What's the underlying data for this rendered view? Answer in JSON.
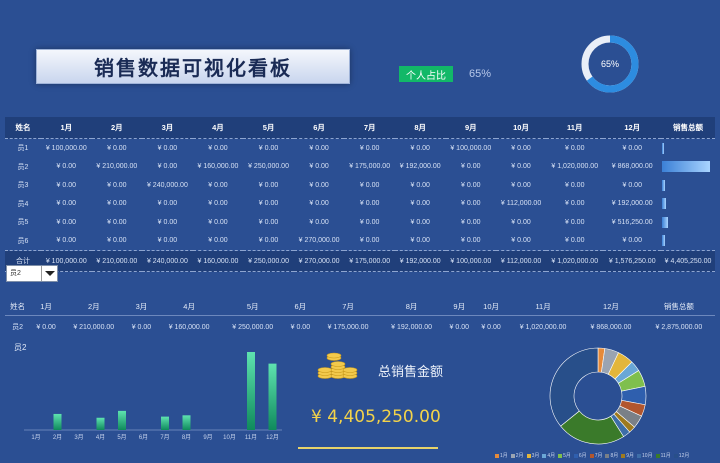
{
  "title": "销售数据可视化看板",
  "tag": "个人占比",
  "percent": "65%",
  "gauge": {
    "label": "65%",
    "value": 0.65
  },
  "table": {
    "headers": [
      "姓名",
      "1月",
      "2月",
      "3月",
      "4月",
      "5月",
      "6月",
      "7月",
      "8月",
      "9月",
      "10月",
      "11月",
      "12月",
      "销售总额"
    ],
    "rows": [
      {
        "name": "员1",
        "values": [
          "¥ 100,000.00",
          "¥ 0.00",
          "¥ 0.00",
          "¥ 0.00",
          "¥ 0.00",
          "¥ 0.00",
          "¥ 0.00",
          "¥ 0.00",
          "¥ 100,000.00",
          "¥ 0.00",
          "¥ 0.00",
          "¥ 0.00"
        ],
        "total_share": 0.03
      },
      {
        "name": "员2",
        "values": [
          "¥ 0.00",
          "¥ 210,000.00",
          "¥ 0.00",
          "¥ 160,000.00",
          "¥ 250,000.00",
          "¥ 0.00",
          "¥ 175,000.00",
          "¥ 192,000.00",
          "¥ 0.00",
          "¥ 0.00",
          "¥ 1,020,000.00",
          "¥ 868,000.00"
        ],
        "total_share": 0.96
      },
      {
        "name": "员3",
        "values": [
          "¥ 0.00",
          "¥ 0.00",
          "¥ 240,000.00",
          "¥ 0.00",
          "¥ 0.00",
          "¥ 0.00",
          "¥ 0.00",
          "¥ 0.00",
          "¥ 0.00",
          "¥ 0.00",
          "¥ 0.00",
          "¥ 0.00"
        ],
        "total_share": 0.05
      },
      {
        "name": "员4",
        "values": [
          "¥ 0.00",
          "¥ 0.00",
          "¥ 0.00",
          "¥ 0.00",
          "¥ 0.00",
          "¥ 0.00",
          "¥ 0.00",
          "¥ 0.00",
          "¥ 0.00",
          "¥ 112,000.00",
          "¥ 0.00",
          "¥ 192,000.00"
        ],
        "total_share": 0.07
      },
      {
        "name": "员5",
        "values": [
          "¥ 0.00",
          "¥ 0.00",
          "¥ 0.00",
          "¥ 0.00",
          "¥ 0.00",
          "¥ 0.00",
          "¥ 0.00",
          "¥ 0.00",
          "¥ 0.00",
          "¥ 0.00",
          "¥ 0.00",
          "¥ 516,250.00"
        ],
        "total_share": 0.12
      },
      {
        "name": "员6",
        "values": [
          "¥ 0.00",
          "¥ 0.00",
          "¥ 0.00",
          "¥ 0.00",
          "¥ 0.00",
          "¥ 270,000.00",
          "¥ 0.00",
          "¥ 0.00",
          "¥ 0.00",
          "¥ 0.00",
          "¥ 0.00",
          "¥ 0.00"
        ],
        "total_share": 0.06
      }
    ],
    "total": {
      "name": "合计",
      "values": [
        "¥ 100,000.00",
        "¥ 210,000.00",
        "¥ 240,000.00",
        "¥ 160,000.00",
        "¥ 250,000.00",
        "¥ 270,000.00",
        "¥ 175,000.00",
        "¥ 192,000.00",
        "¥ 100,000.00",
        "¥ 112,000.00",
        "¥ 1,020,000.00",
        "¥ 1,576,250.00"
      ],
      "grand": "¥ 4,405,250.00"
    }
  },
  "selector": {
    "value": "员2"
  },
  "detail": {
    "headers": [
      "姓名",
      "1月",
      "2月",
      "3月",
      "4月",
      "5月",
      "6月",
      "7月",
      "8月",
      "9月",
      "10月",
      "11月",
      "12月",
      "销售总额"
    ],
    "row": [
      "员2",
      "¥ 0.00",
      "¥ 210,000.00",
      "¥ 0.00",
      "¥ 160,000.00",
      "¥ 250,000.00",
      "¥ 0.00",
      "¥ 175,000.00",
      "¥ 192,000.00",
      "¥ 0.00",
      "¥ 0.00",
      "¥ 1,020,000.00",
      "¥ 868,000.00",
      "¥ 2,875,000.00"
    ]
  },
  "summary": {
    "label": "总销售金额",
    "value": "¥ 4,405,250.00"
  },
  "colors": {
    "bg": "#2b4f93",
    "accent_green": "#12b868",
    "gold": "#f3d34a"
  },
  "chart_data": [
    {
      "type": "bar",
      "title": "员2",
      "categories": [
        "1月",
        "2月",
        "3月",
        "4月",
        "5月",
        "6月",
        "7月",
        "8月",
        "9月",
        "10月",
        "11月",
        "12月"
      ],
      "values": [
        0,
        210000,
        0,
        160000,
        250000,
        0,
        175000,
        192000,
        0,
        0,
        1020000,
        868000
      ]
    },
    {
      "type": "pie",
      "categories": [
        "1月",
        "2月",
        "3月",
        "4月",
        "5月",
        "6月",
        "7月",
        "8月",
        "9月",
        "10月",
        "11月",
        "12月"
      ],
      "values": [
        100000,
        210000,
        240000,
        160000,
        250000,
        270000,
        175000,
        192000,
        100000,
        112000,
        1020000,
        1576250
      ],
      "colors": [
        "#e58a3a",
        "#9aa4b2",
        "#e3b63b",
        "#6aa7d6",
        "#7fbf4d",
        "#2f5fae",
        "#b2562e",
        "#7a8087",
        "#9e7a1f",
        "#3d6ea8",
        "#3a7a2a",
        "#284f8a"
      ]
    }
  ]
}
